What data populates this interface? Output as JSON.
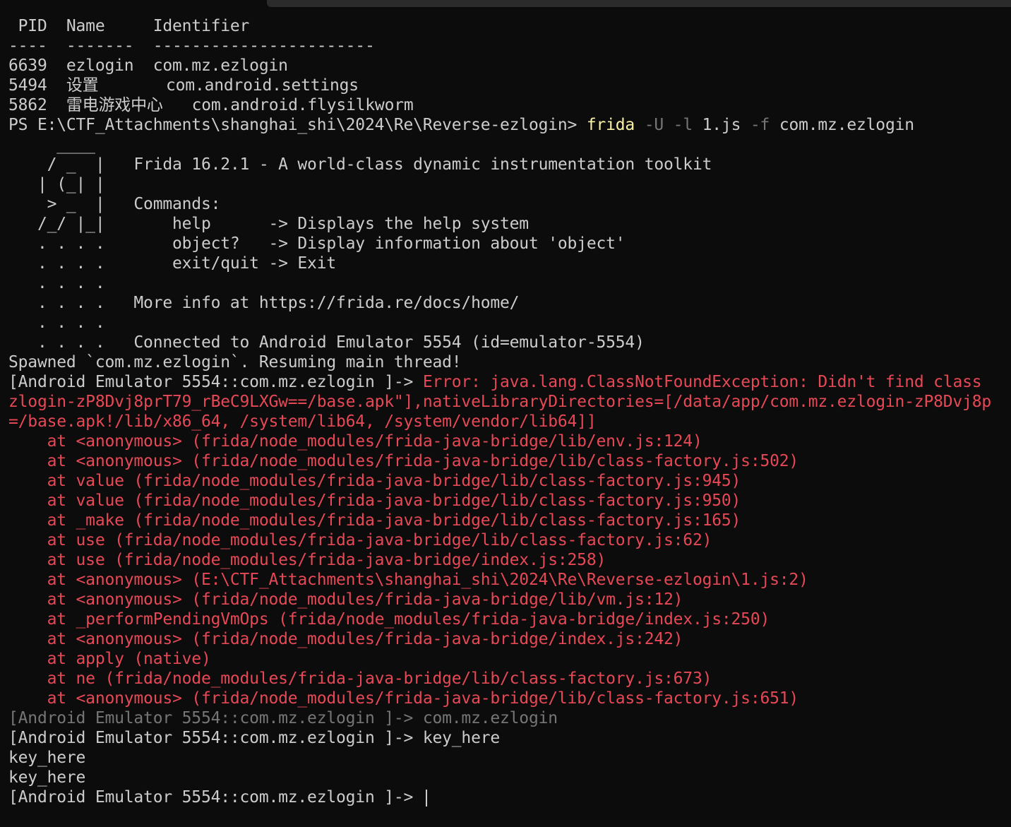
{
  "colors": {
    "background": "#0c0c0c",
    "foreground": "#cccccc",
    "error": "#e74856",
    "command": "#f9f1a5",
    "dim": "#767676"
  },
  "lines": [
    {
      "segments": [
        {
          "text": " PID  Name     Identifier"
        }
      ]
    },
    {
      "segments": [
        {
          "text": "----  -------  -----------------------"
        }
      ]
    },
    {
      "segments": [
        {
          "text": "6639  ezlogin  com.mz.ezlogin"
        }
      ]
    },
    {
      "segments": [
        {
          "text": "5494  设置       com.android.settings"
        }
      ]
    },
    {
      "segments": [
        {
          "text": "5862  雷电游戏中心   com.android.flysilkworm"
        }
      ]
    },
    {
      "segments": [
        {
          "text": "PS E:\\CTF_Attachments\\shanghai_shi\\2024\\Re\\Reverse-ezlogin> "
        },
        {
          "text": "frida",
          "cls": "yellow"
        },
        {
          "text": " -U -l",
          "cls": "gray"
        },
        {
          "text": " 1.js "
        },
        {
          "text": "-f",
          "cls": "gray"
        },
        {
          "text": " com.mz.ezlogin"
        }
      ]
    },
    {
      "segments": [
        {
          "text": "     ____"
        }
      ]
    },
    {
      "segments": [
        {
          "text": "    / _  |   Frida 16.2.1 - A world-class dynamic instrumentation toolkit"
        }
      ]
    },
    {
      "segments": [
        {
          "text": "   | (_| |"
        }
      ]
    },
    {
      "segments": [
        {
          "text": "    > _  |   Commands:"
        }
      ]
    },
    {
      "segments": [
        {
          "text": "   /_/ |_|       help      -> Displays the help system"
        }
      ]
    },
    {
      "segments": [
        {
          "text": "   . . . .       object?   -> Display information about 'object'"
        }
      ]
    },
    {
      "segments": [
        {
          "text": "   . . . .       exit/quit -> Exit"
        }
      ]
    },
    {
      "segments": [
        {
          "text": "   . . . ."
        }
      ]
    },
    {
      "segments": [
        {
          "text": "   . . . .   More info at https://frida.re/docs/home/"
        }
      ]
    },
    {
      "segments": [
        {
          "text": "   . . . ."
        }
      ]
    },
    {
      "segments": [
        {
          "text": "   . . . .   Connected to Android Emulator 5554 (id=emulator-5554)"
        }
      ]
    },
    {
      "segments": [
        {
          "text": "Spawned `com.mz.ezlogin`. Resuming main thread!"
        }
      ]
    },
    {
      "segments": [
        {
          "text": "[Android Emulator 5554::com.mz.ezlogin ]-> "
        },
        {
          "text": "Error: java.lang.ClassNotFoundException: Didn't find class",
          "cls": "red"
        }
      ]
    },
    {
      "segments": [
        {
          "text": "zlogin-zP8Dvj8prT79_rBeC9LXGw==/base.apk\"],nativeLibraryDirectories=[/data/app/com.mz.ezlogin-zP8Dvj8p",
          "cls": "red"
        }
      ]
    },
    {
      "segments": [
        {
          "text": "=/base.apk!/lib/x86_64, /system/lib64, /system/vendor/lib64]]",
          "cls": "red"
        }
      ]
    },
    {
      "segments": [
        {
          "text": "    at <anonymous> (frida/node_modules/frida-java-bridge/lib/env.js:124)",
          "cls": "red"
        }
      ]
    },
    {
      "segments": [
        {
          "text": "    at <anonymous> (frida/node_modules/frida-java-bridge/lib/class-factory.js:502)",
          "cls": "red"
        }
      ]
    },
    {
      "segments": [
        {
          "text": "    at value (frida/node_modules/frida-java-bridge/lib/class-factory.js:945)",
          "cls": "red"
        }
      ]
    },
    {
      "segments": [
        {
          "text": "    at value (frida/node_modules/frida-java-bridge/lib/class-factory.js:950)",
          "cls": "red"
        }
      ]
    },
    {
      "segments": [
        {
          "text": "    at _make (frida/node_modules/frida-java-bridge/lib/class-factory.js:165)",
          "cls": "red"
        }
      ]
    },
    {
      "segments": [
        {
          "text": "    at use (frida/node_modules/frida-java-bridge/lib/class-factory.js:62)",
          "cls": "red"
        }
      ]
    },
    {
      "segments": [
        {
          "text": "    at use (frida/node_modules/frida-java-bridge/index.js:258)",
          "cls": "red"
        }
      ]
    },
    {
      "segments": [
        {
          "text": "    at <anonymous> (E:\\CTF_Attachments\\shanghai_shi\\2024\\Re\\Reverse-ezlogin\\1.js:2)",
          "cls": "red"
        }
      ]
    },
    {
      "segments": [
        {
          "text": "    at <anonymous> (frida/node_modules/frida-java-bridge/lib/vm.js:12)",
          "cls": "red"
        }
      ]
    },
    {
      "segments": [
        {
          "text": "    at _performPendingVmOps (frida/node_modules/frida-java-bridge/index.js:250)",
          "cls": "red"
        }
      ]
    },
    {
      "segments": [
        {
          "text": "    at <anonymous> (frida/node_modules/frida-java-bridge/index.js:242)",
          "cls": "red"
        }
      ]
    },
    {
      "segments": [
        {
          "text": "    at apply (native)",
          "cls": "red"
        }
      ]
    },
    {
      "segments": [
        {
          "text": "    at ne (frida/node_modules/frida-java-bridge/lib/class-factory.js:673)",
          "cls": "red"
        }
      ]
    },
    {
      "segments": [
        {
          "text": "    at <anonymous> (frida/node_modules/frida-java-bridge/lib/class-factory.js:651)",
          "cls": "red"
        }
      ]
    },
    {
      "segments": [
        {
          "text": "[Android Emulator 5554::com.mz.ezlogin ]-> com.mz.ezlogin",
          "cls": "gray"
        }
      ]
    },
    {
      "segments": [
        {
          "text": "[Android Emulator 5554::com.mz.ezlogin ]-> key_here"
        }
      ]
    },
    {
      "segments": [
        {
          "text": "key_here"
        }
      ]
    },
    {
      "segments": [
        {
          "text": "key_here"
        }
      ]
    },
    {
      "segments": [
        {
          "text": "[Android Emulator 5554::com.mz.ezlogin ]-> "
        }
      ],
      "cursor": true
    }
  ]
}
